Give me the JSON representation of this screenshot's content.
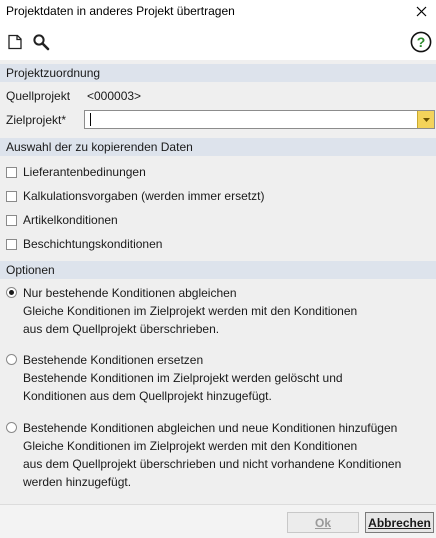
{
  "window": {
    "title": "Projektdaten in anderes Projekt übertragen"
  },
  "toolbar": {
    "icons": [
      "new-document-icon",
      "search-icon",
      "help-icon"
    ],
    "help_glyph": "?"
  },
  "assignment": {
    "header": "Projektzuordnung",
    "source_label": "Quellprojekt",
    "source_value": "<000003>",
    "target_label": "Zielprojekt*",
    "target_value": ""
  },
  "data_selection": {
    "header": "Auswahl der zu kopierenden Daten",
    "items": [
      {
        "label": "Lieferantenbedinungen",
        "checked": false
      },
      {
        "label": "Kalkulationsvorgaben (werden immer ersetzt)",
        "checked": false
      },
      {
        "label": "Artikelkonditionen",
        "checked": false
      },
      {
        "label": "Beschichtungskonditionen",
        "checked": false
      }
    ]
  },
  "options": {
    "header": "Optionen",
    "items": [
      {
        "selected": true,
        "lines": [
          "Nur bestehende Konditionen abgleichen",
          "Gleiche Konditionen im Zielprojekt werden mit den Konditionen",
          "aus dem Quellprojekt überschrieben."
        ]
      },
      {
        "selected": false,
        "lines": [
          "Bestehende Konditionen ersetzen",
          "Bestehende Konditionen im Zielprojekt werden gelöscht und",
          "Konditionen aus dem Quellprojekt hinzugefügt."
        ]
      },
      {
        "selected": false,
        "lines": [
          "Bestehende Konditionen abgleichen und neue Konditionen hinzufügen",
          "Gleiche Konditionen im Zielprojekt werden mit den Konditionen",
          "aus dem Quellprojekt überschrieben und nicht vorhandene Konditionen",
          "werden hinzugefügt."
        ]
      }
    ]
  },
  "footer": {
    "ok_label": "Ok",
    "ok_enabled": false,
    "cancel_label": "Abbrechen"
  },
  "colors": {
    "section_header": "#dde3ec",
    "content_bg": "#efefef",
    "dropdown_accent": "#f3d35a",
    "help_green": "#2e8b2e"
  }
}
